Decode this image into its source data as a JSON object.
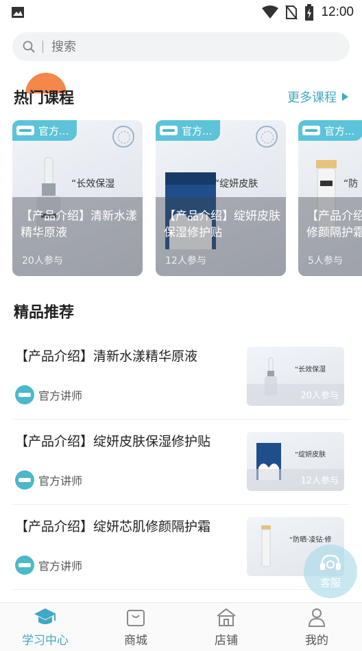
{
  "status_bar": {
    "time": "12:00"
  },
  "search": {
    "placeholder": "搜索"
  },
  "hot_courses": {
    "title": "热门课程",
    "more_label": "更多课程",
    "cards": [
      {
        "badge": "官方...",
        "slogan": "“长效保湿",
        "title": "【产品介绍】清新水漾精华原液",
        "count": "20人参与"
      },
      {
        "badge": "官方...",
        "slogan": "“绽妍皮肤",
        "title": "【产品介绍】绽妍皮肤保湿修护贴",
        "count": "12人参与"
      },
      {
        "badge": "官方...",
        "slogan": "“防",
        "title": "【产品介绍】绽妍芯肌修颜隔护霜",
        "count": "5人参与"
      }
    ]
  },
  "recommended": {
    "title": "精品推荐",
    "items": [
      {
        "title": "【产品介绍】清新水漾精华原液",
        "teacher": "官方讲师",
        "thumb_slogan": "“长效保湿",
        "thumb_count": "20人参与"
      },
      {
        "title": "【产品介绍】绽妍皮肤保湿修护贴",
        "teacher": "官方讲师",
        "thumb_slogan": "“绽妍皮肤",
        "thumb_count": "12人参与"
      },
      {
        "title": "【产品介绍】绽妍芯肌修颜隔护霜",
        "teacher": "官方讲师",
        "thumb_slogan": "“防晒·凌钻·修",
        "thumb_count": ""
      }
    ]
  },
  "service": {
    "label": "客服"
  },
  "tabbar": {
    "tabs": [
      {
        "label": "学习中心",
        "icon": "graduation-cap-icon",
        "active": true
      },
      {
        "label": "商城",
        "icon": "shopping-bag-icon",
        "active": false
      },
      {
        "label": "店铺",
        "icon": "store-icon",
        "active": false
      },
      {
        "label": "我的",
        "icon": "user-icon",
        "active": false
      }
    ]
  },
  "colors": {
    "accent": "#3fa9c5",
    "badge": "#5dc3d8",
    "decor": "#f5874a"
  }
}
